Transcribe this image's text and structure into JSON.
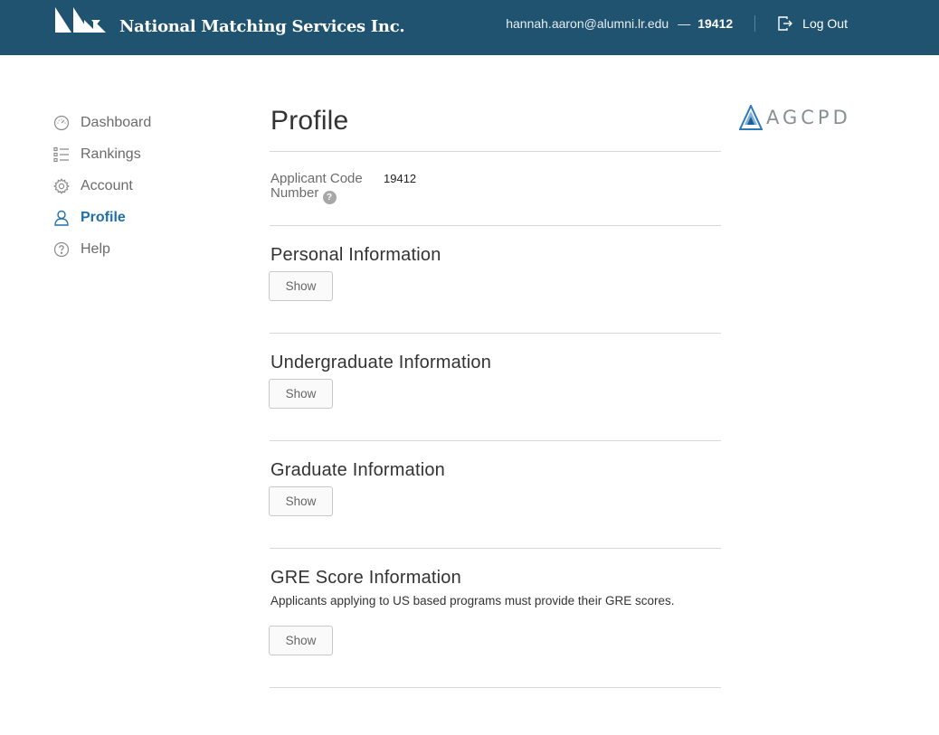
{
  "header": {
    "brand_name": "National Matching Services Inc.",
    "user_email": "hannah.aaron@alumni.lr.edu",
    "separator": "—",
    "user_code": "19412",
    "logout_label": "Log Out"
  },
  "sidebar": {
    "items": [
      {
        "label": "Dashboard",
        "icon": "dashboard-icon"
      },
      {
        "label": "Rankings",
        "icon": "list-icon"
      },
      {
        "label": "Account",
        "icon": "gear-icon"
      },
      {
        "label": "Profile",
        "icon": "user-icon",
        "active": true
      },
      {
        "label": "Help",
        "icon": "question-icon"
      }
    ]
  },
  "main": {
    "title": "Profile",
    "applicant_code_label": "Applicant Code Number",
    "applicant_code_value": "19412",
    "help_glyph": "?",
    "sections": [
      {
        "title": "Personal Information",
        "button": "Show"
      },
      {
        "title": "Undergraduate Information",
        "button": "Show"
      },
      {
        "title": "Graduate Information",
        "button": "Show"
      },
      {
        "title": "GRE Score Information",
        "note": "Applicants applying to US based programs must provide their GRE scores.",
        "button": "Show"
      }
    ]
  },
  "org_logo": {
    "text": "AGCPD"
  },
  "colors": {
    "header_bg": "#1f5370",
    "active_link": "#1f6fab",
    "text_muted": "#6b6b6b"
  }
}
